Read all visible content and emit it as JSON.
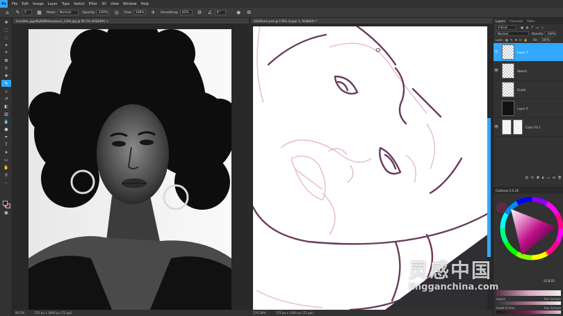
{
  "app": {
    "logo": "Ps"
  },
  "menu": [
    "File",
    "Edit",
    "Image",
    "Layer",
    "Type",
    "Select",
    "Filter",
    "3D",
    "View",
    "Window",
    "Help"
  ],
  "options": {
    "mode_label": "Mode:",
    "mode_value": "Normal",
    "opacity_label": "Opacity:",
    "opacity_value": "100%",
    "flow_label": "Flow:",
    "flow_value": "100%",
    "smoothing_label": "Smoothing:",
    "smoothing_value": "42%",
    "angle_value": "0°",
    "brush_size": "5"
  },
  "doc1": {
    "tab": "Invisible_pgp4Ky8WEHoourJourl_1200.jpg @ 95.5% (RGB/8#) ×",
    "zoom": "95.5%",
    "size": "725 px x 1000 px (72 ppi)"
  },
  "doc2": {
    "tab": "SkillShare.psd @ 176% (Layer 1, RGB/8#) *",
    "zoom": "176.29%",
    "size": "725 px x 1000 px (72 ppi)"
  },
  "layers_panel": {
    "tabs": [
      "Layers",
      "Channels",
      "Paths"
    ],
    "filter_label": "Kind",
    "blend": "Normal",
    "opacity_label": "Opacity:",
    "opacity_value": "100%",
    "lock_label": "Lock:",
    "fill_label": "Fill:",
    "fill_value": "100%",
    "layers": [
      {
        "name": "Layer 1",
        "selected": true
      },
      {
        "name": "Sketch",
        "selected": false
      },
      {
        "name": "Guide",
        "selected": false
      },
      {
        "name": "Layer 0",
        "selected": false
      },
      {
        "name": "Color Fill 1",
        "selected": false
      }
    ]
  },
  "coolorus": {
    "title": "Coolorus 2.5.16",
    "hex": "513C42",
    "sliders": [
      "Layers",
      "Hue Sample",
      "Hudst & thou",
      "Hue Sample"
    ]
  },
  "colors": {
    "accent": "#31a8ff",
    "fg": "#1d1d1d",
    "bg": "#7a2050"
  },
  "watermark": {
    "cn": "灵感中国",
    "en": "lingganchina.com"
  }
}
